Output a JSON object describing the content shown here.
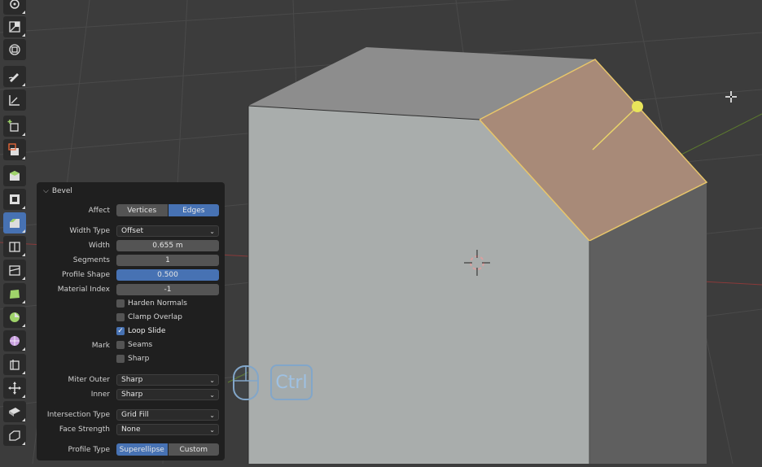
{
  "viewport": {
    "accent": "#4772b3",
    "selection_color": "#e8c66a",
    "face_selected_color": "#a88a78"
  },
  "toolbar": {
    "tools": [
      {
        "icon": "rotate-icon"
      },
      {
        "icon": "scale-icon"
      },
      {
        "icon": "transform-icon"
      },
      {
        "icon": "annotate-icon"
      },
      {
        "icon": "measure-icon"
      },
      {
        "icon": "add-cube-icon"
      },
      {
        "icon": "extrude-region-icon"
      },
      {
        "icon": "extrude-manifold-icon"
      },
      {
        "icon": "inset-faces-icon"
      },
      {
        "icon": "bevel-icon",
        "active": true
      },
      {
        "icon": "loop-cut-icon"
      },
      {
        "icon": "knife-icon"
      },
      {
        "icon": "poly-build-icon"
      },
      {
        "icon": "spin-icon"
      },
      {
        "icon": "smooth-icon"
      },
      {
        "icon": "edge-slide-icon"
      },
      {
        "icon": "shrink-fatten-icon"
      },
      {
        "icon": "shear-icon"
      },
      {
        "icon": "rip-region-icon"
      }
    ]
  },
  "panel": {
    "title": "Bevel",
    "affect": {
      "label": "Affect",
      "options": [
        "Vertices",
        "Edges"
      ],
      "selected": "Edges"
    },
    "width_type": {
      "label": "Width Type",
      "value": "Offset"
    },
    "width": {
      "label": "Width",
      "value": "0.655 m"
    },
    "segments": {
      "label": "Segments",
      "value": "1"
    },
    "profile_shape": {
      "label": "Profile Shape",
      "value": "0.500"
    },
    "material_index": {
      "label": "Material Index",
      "value": "-1"
    },
    "harden_normals": {
      "label": "Harden Normals",
      "checked": false
    },
    "clamp_overlap": {
      "label": "Clamp Overlap",
      "checked": false
    },
    "loop_slide": {
      "label": "Loop Slide",
      "checked": true,
      "mark": "✓"
    },
    "mark": {
      "label": "Mark"
    },
    "seams": {
      "label": "Seams",
      "checked": false
    },
    "sharp": {
      "label": "Sharp",
      "checked": false
    },
    "miter_outer": {
      "label": "Miter Outer",
      "value": "Sharp"
    },
    "inner": {
      "label": "Inner",
      "value": "Sharp"
    },
    "intersection_type": {
      "label": "Intersection Type",
      "value": "Grid Fill"
    },
    "face_strength": {
      "label": "Face Strength",
      "value": "None"
    },
    "profile_type": {
      "label": "Profile Type",
      "options": [
        "Superellipse",
        "Custom"
      ],
      "selected": "Superellipse"
    }
  },
  "key_overlay": {
    "mouse_icon": "mouse-icon",
    "key": "Ctrl"
  }
}
